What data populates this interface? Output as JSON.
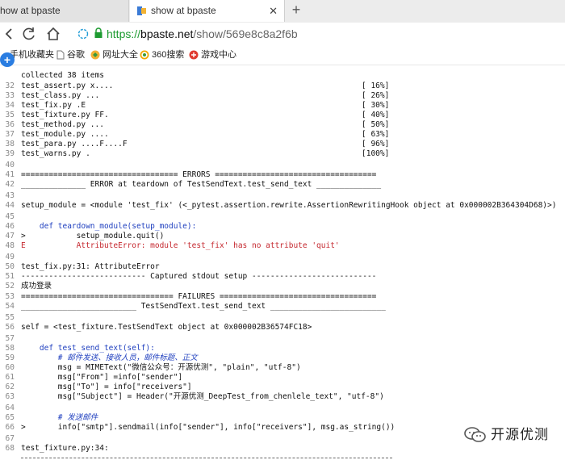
{
  "tabs": [
    {
      "title": "how at bpaste",
      "active": false
    },
    {
      "title": "show at bpaste",
      "active": true
    }
  ],
  "address_bar": {
    "scheme": "https://",
    "host": "bpaste.net",
    "path": "/show/569e8c8a2f6b"
  },
  "bookmarks": [
    {
      "label": "手机收藏夹",
      "icon": "phone-icon"
    },
    {
      "label": "谷歌",
      "icon": "page-icon"
    },
    {
      "label": "网址大全",
      "icon": "globe-icon"
    },
    {
      "label": "360搜索",
      "icon": "search-360-icon"
    },
    {
      "label": "游戏中心",
      "icon": "game-icon"
    }
  ],
  "code": {
    "partial_top": "collected 38 items",
    "lines": [
      {
        "n": "32",
        "text": "test_assert.py x....",
        "pct": "[ 16%]"
      },
      {
        "n": "33",
        "text": "test_class.py ...",
        "pct": "[ 26%]"
      },
      {
        "n": "34",
        "text": "test_fix.py .E",
        "pct": "[ 30%]"
      },
      {
        "n": "35",
        "text": "test_fixture.py FF.",
        "pct": "[ 40%]"
      },
      {
        "n": "36",
        "text": "test_method.py ...",
        "pct": "[ 50%]"
      },
      {
        "n": "37",
        "text": "test_module.py ....",
        "pct": "[ 63%]"
      },
      {
        "n": "38",
        "text": "test_para.py ....F....F",
        "pct": "[ 96%]"
      },
      {
        "n": "39",
        "text": "test_warns.py .",
        "pct": "[100%]"
      },
      {
        "n": "40",
        "text": ""
      },
      {
        "n": "41",
        "text": "================================== ERRORS ==================================="
      },
      {
        "n": "42",
        "text": "______________ ERROR at teardown of TestSendText.test_send_text ______________"
      },
      {
        "n": "43",
        "text": ""
      },
      {
        "n": "44",
        "text": "setup_module = <module 'test_fix' (<_pytest.assertion.rewrite.AssertionRewritingHook object at 0x000002B364304D68)>)"
      },
      {
        "n": "45",
        "text": ""
      },
      {
        "n": "46",
        "text": "    def teardown_module(setup_module):"
      },
      {
        "n": "47",
        "text": ">           setup_module.quit()"
      },
      {
        "n": "48",
        "text": "E           AttributeError: module 'test_fix' has no attribute 'quit'"
      },
      {
        "n": "49",
        "text": ""
      },
      {
        "n": "50",
        "text": "test_fix.py:31: AttributeError"
      },
      {
        "n": "51",
        "text": "--------------------------- Captured stdout setup ---------------------------"
      },
      {
        "n": "52",
        "text": "成功登录"
      },
      {
        "n": "53",
        "text": "================================= FAILURES =================================="
      },
      {
        "n": "54",
        "text": "_________________________ TestSendText.test_send_text _________________________"
      },
      {
        "n": "55",
        "text": ""
      },
      {
        "n": "56",
        "text": "self = <test_fixture.TestSendText object at 0x000002B36574FC18>"
      },
      {
        "n": "57",
        "text": ""
      },
      {
        "n": "58",
        "text": "    def test_send_text(self):"
      },
      {
        "n": "59",
        "text": "        # 邮件发送、接收人员，邮件标题、正文"
      },
      {
        "n": "60",
        "text": "        msg = MIMEText(\"微信公众号：开源优测\", \"plain\", \"utf-8\")"
      },
      {
        "n": "61",
        "text": "        msg[\"From\"] =info[\"sender\"]"
      },
      {
        "n": "62",
        "text": "        msg[\"To\"] = info[\"receivers\"]"
      },
      {
        "n": "63",
        "text": "        msg[\"Subject\"] = Header(\"开源优测_DeepTest_from_chenlele_text\", \"utf-8\")"
      },
      {
        "n": "64",
        "text": ""
      },
      {
        "n": "65",
        "text": "        # 发送邮件"
      },
      {
        "n": "66",
        "text": ">       info[\"smtp\"].sendmail(info[\"sender\"], info[\"receivers\"], msg.as_string())"
      },
      {
        "n": "67",
        "text": ""
      },
      {
        "n": "68",
        "text": "test_fixture.py:34:"
      }
    ]
  },
  "watermark": {
    "text": "开源优测"
  },
  "colors": {
    "accent": "#2a7de1",
    "secure_green": "#1e9b31",
    "error_red": "#c5282f",
    "keyword_blue": "#1f3fbf"
  }
}
